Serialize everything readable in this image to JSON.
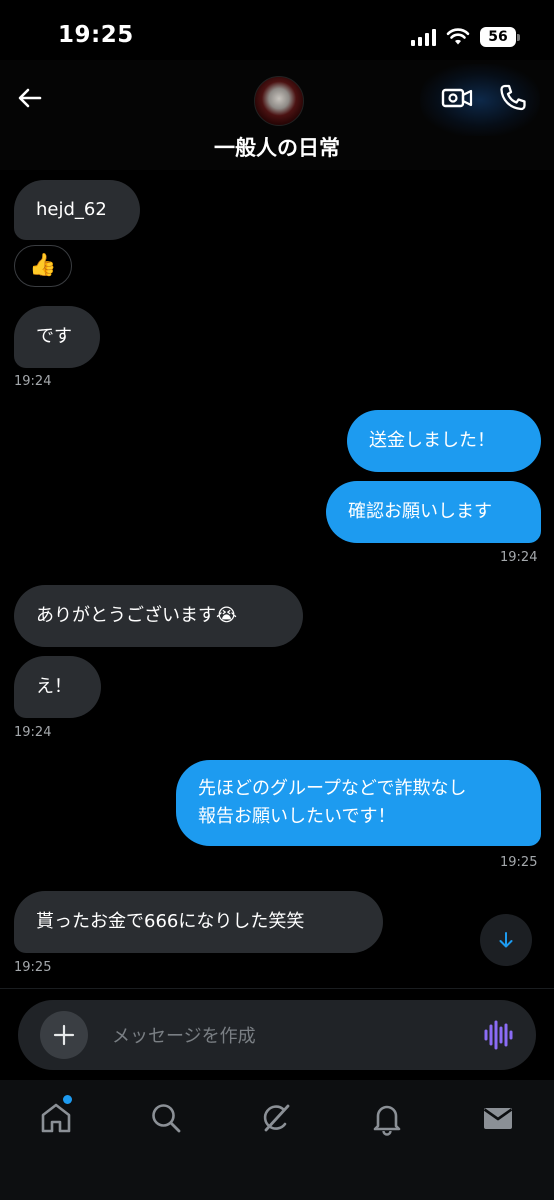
{
  "status_bar": {
    "time": "19:25",
    "battery": "56"
  },
  "header": {
    "title": "一般人の日常"
  },
  "messages": {
    "m1": "hejd_62",
    "m2": "👍",
    "m3": "です",
    "t1": "19:24",
    "m4": "送金しました！",
    "m5": "確認お願いします",
    "t2": "19:24",
    "m6": "ありがとうございます😭",
    "m7": "え！",
    "t3": "19:24",
    "m8_line1": "先ほどのグループなどで詐欺なし",
    "m8_line2": "報告お願いしたいです！",
    "t4": "19:25",
    "m9": "貰ったお金で666になりした笑笑",
    "t5": "19:25"
  },
  "composer": {
    "placeholder": "メッセージを作成"
  },
  "colors": {
    "accent": "#1d9bf0",
    "incoming_bubble": "#2a2d31",
    "background": "#000000"
  },
  "icons": {
    "back": "arrow-left-icon",
    "video": "video-camera-icon",
    "call": "phone-icon",
    "scroll": "arrow-down-icon",
    "add": "plus-icon",
    "voice": "voice-waveform-icon",
    "nav": [
      "home-icon",
      "search-icon",
      "grok-icon",
      "bell-icon",
      "mail-icon"
    ]
  }
}
